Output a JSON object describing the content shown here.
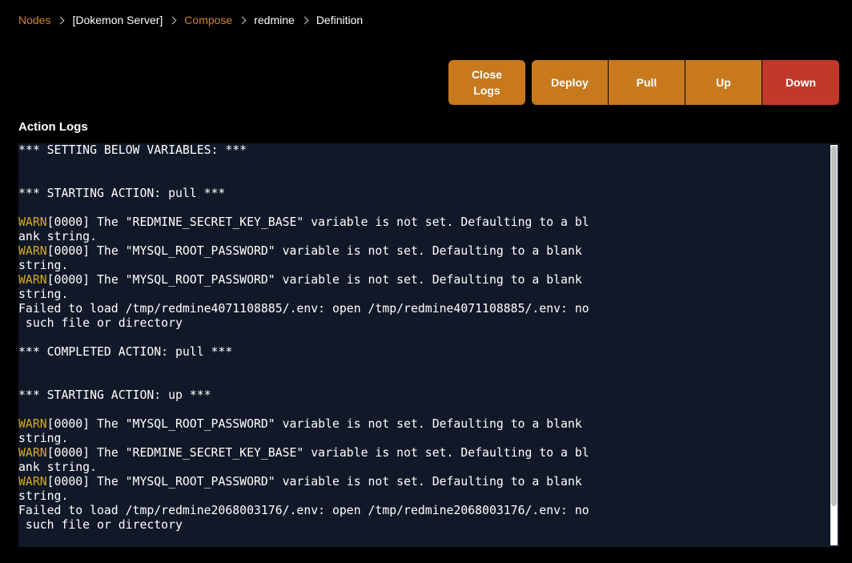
{
  "breadcrumb": {
    "items": [
      {
        "label": "Nodes"
      },
      {
        "label": "[Dokemon Server]"
      },
      {
        "label": "Compose"
      },
      {
        "label": "redmine"
      },
      {
        "label": "Definition"
      }
    ]
  },
  "toolbar": {
    "close_logs_label": "Close\nLogs",
    "deploy_label": "Deploy",
    "pull_label": "Pull",
    "up_label": "Up",
    "down_label": "Down"
  },
  "colors": {
    "accent": "#c8791e",
    "danger": "#c0392b",
    "link": "#d4822a",
    "warn": "#d4a828",
    "log_background": "#111827"
  },
  "logs": {
    "title": "Action Logs",
    "lines": [
      {
        "text": "*** SETTING BELOW VARIABLES: ***"
      },
      {
        "text": ""
      },
      {
        "text": ""
      },
      {
        "text": "*** STARTING ACTION: pull ***"
      },
      {
        "text": ""
      },
      {
        "warn": "WARN",
        "text": "[0000] The \"REDMINE_SECRET_KEY_BASE\" variable is not set. Defaulting to a bl"
      },
      {
        "text": "ank string."
      },
      {
        "warn": "WARN",
        "text": "[0000] The \"MYSQL_ROOT_PASSWORD\" variable is not set. Defaulting to a blank"
      },
      {
        "text": "string."
      },
      {
        "warn": "WARN",
        "text": "[0000] The \"MYSQL_ROOT_PASSWORD\" variable is not set. Defaulting to a blank"
      },
      {
        "text": "string."
      },
      {
        "text": "Failed to load /tmp/redmine4071108885/.env: open /tmp/redmine4071108885/.env: no"
      },
      {
        "text": " such file or directory"
      },
      {
        "text": ""
      },
      {
        "text": "*** COMPLETED ACTION: pull ***"
      },
      {
        "text": ""
      },
      {
        "text": ""
      },
      {
        "text": "*** STARTING ACTION: up ***"
      },
      {
        "text": ""
      },
      {
        "warn": "WARN",
        "text": "[0000] The \"MYSQL_ROOT_PASSWORD\" variable is not set. Defaulting to a blank"
      },
      {
        "text": "string."
      },
      {
        "warn": "WARN",
        "text": "[0000] The \"REDMINE_SECRET_KEY_BASE\" variable is not set. Defaulting to a bl"
      },
      {
        "text": "ank string."
      },
      {
        "warn": "WARN",
        "text": "[0000] The \"MYSQL_ROOT_PASSWORD\" variable is not set. Defaulting to a blank"
      },
      {
        "text": "string."
      },
      {
        "text": "Failed to load /tmp/redmine2068003176/.env: open /tmp/redmine2068003176/.env: no"
      },
      {
        "text": " such file or directory"
      }
    ]
  }
}
